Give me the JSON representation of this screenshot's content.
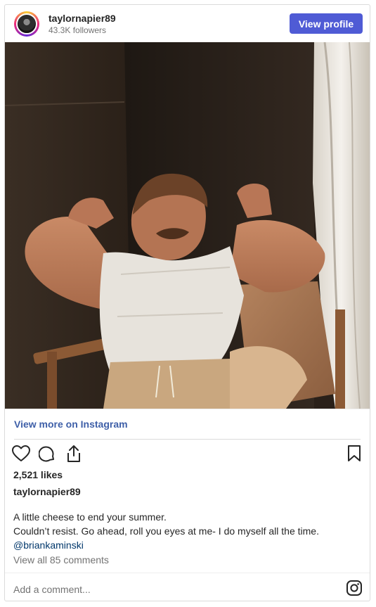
{
  "header": {
    "username": "taylornapier89",
    "followers": "43.3K followers",
    "view_profile_label": "View profile"
  },
  "post": {
    "view_more_label": "View more on Instagram",
    "likes": "2,521 likes",
    "caption_user": "taylornapier89",
    "caption_lines": [
      "A little cheese to end your summer.",
      "Couldn’t resist. Go ahead, roll you eyes at me- I do myself all the time."
    ],
    "mention": "@briankaminski",
    "view_comments": "View all 85 comments"
  },
  "footer": {
    "add_comment_placeholder": "Add a comment..."
  },
  "icons": {
    "like": "heart-icon",
    "comment": "comment-icon",
    "share": "share-icon",
    "save": "bookmark-icon",
    "brand": "instagram-icon"
  },
  "colors": {
    "accent": "#4f5bd5",
    "link": "#3e5fa8",
    "mention": "#00376b",
    "muted": "#737373"
  }
}
